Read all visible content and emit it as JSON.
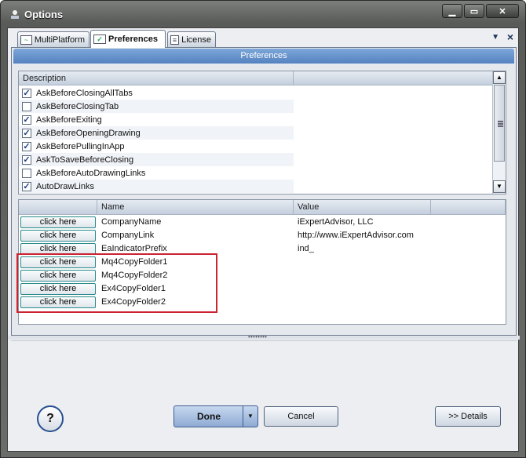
{
  "window": {
    "title": "Options"
  },
  "tabs": [
    {
      "label": "MultiPlatform"
    },
    {
      "label": "Preferences"
    },
    {
      "label": "License"
    }
  ],
  "pane": {
    "header": "Preferences"
  },
  "preferences_list": {
    "column_header": "Description",
    "items": [
      {
        "label": "AskBeforeClosingAllTabs",
        "checked": true
      },
      {
        "label": "AskBeforeClosingTab",
        "checked": false
      },
      {
        "label": "AskBeforeExiting",
        "checked": true
      },
      {
        "label": "AskBeforeOpeningDrawing",
        "checked": true
      },
      {
        "label": "AskBeforePullingInApp",
        "checked": true
      },
      {
        "label": "AskToSaveBeforeClosing",
        "checked": true
      },
      {
        "label": "AskBeforeAutoDrawingLinks",
        "checked": false
      },
      {
        "label": "AutoDrawLinks",
        "checked": true
      }
    ]
  },
  "settings_grid": {
    "columns": {
      "name": "Name",
      "value": "Value"
    },
    "button_label": "click here",
    "rows": [
      {
        "name": "CompanyName",
        "value": "iExpertAdvisor, LLC"
      },
      {
        "name": "CompanyLink",
        "value": "http://www.iExpertAdvisor.com"
      },
      {
        "name": "EaIndicatorPrefix",
        "value": "ind_"
      },
      {
        "name": "Mq4CopyFolder1",
        "value": ""
      },
      {
        "name": "Mq4CopyFolder2",
        "value": ""
      },
      {
        "name": "Ex4CopyFolder1",
        "value": ""
      },
      {
        "name": "Ex4CopyFolder2",
        "value": ""
      }
    ]
  },
  "buttons": {
    "help": "?",
    "done": "Done",
    "cancel": "Cancel",
    "details": ">> Details"
  },
  "colors": {
    "header_blue": "#5482c0",
    "highlight_red": "#cc2231",
    "button_border_teal": "#2a8a8a"
  }
}
